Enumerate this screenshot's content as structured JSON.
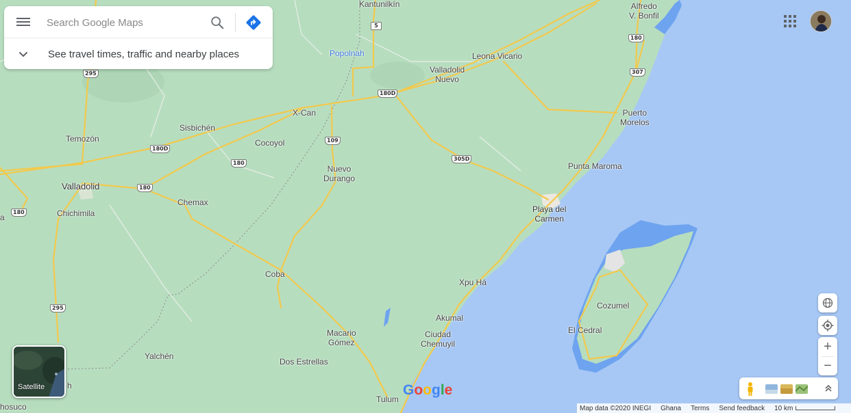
{
  "search": {
    "placeholder": "Search Google Maps",
    "travel_text": "See travel times, traffic and nearby places"
  },
  "map": {
    "places": [
      {
        "label": "Kantunilkín"
      },
      {
        "label": "Alfredo\nV. Bonfil"
      },
      {
        "label": "Popolnah",
        "style": "water"
      },
      {
        "label": "Leona Vicario"
      },
      {
        "label": "Valladolid\nNuevo"
      },
      {
        "label": "X-Can"
      },
      {
        "label": "Sisbichén"
      },
      {
        "label": "Temozón"
      },
      {
        "label": "Cocoyol"
      },
      {
        "label": "Nuevo\nDurango"
      },
      {
        "label": "Puerto\nMorelos"
      },
      {
        "label": "Valladolid"
      },
      {
        "label": "Chemax"
      },
      {
        "label": "Chichimila"
      },
      {
        "label": "Punta Maroma"
      },
      {
        "label": "Playa del\nCarmen"
      },
      {
        "label": "Coba"
      },
      {
        "label": "Xpu Há"
      },
      {
        "label": "Cozumel"
      },
      {
        "label": "El Cedral"
      },
      {
        "label": "Akumal"
      },
      {
        "label": "Ciudad\nChemuyil"
      },
      {
        "label": "Macario\nGómez"
      },
      {
        "label": "Yalchén"
      },
      {
        "label": "Dos Estrellas"
      },
      {
        "label": "Tulum"
      },
      {
        "label": "hosuco"
      },
      {
        "label": "a"
      },
      {
        "label": "h"
      }
    ],
    "shields": [
      {
        "label": "5"
      },
      {
        "label": "180"
      },
      {
        "label": "295"
      },
      {
        "label": "307"
      },
      {
        "label": "180D"
      },
      {
        "label": "180D"
      },
      {
        "label": "109"
      },
      {
        "label": "180"
      },
      {
        "label": "305D"
      },
      {
        "label": "180"
      },
      {
        "label": "180"
      },
      {
        "label": "295"
      }
    ]
  },
  "controls": {
    "satellite_label": "Satellite",
    "zoom_in": "+",
    "zoom_out": "−"
  },
  "footer": {
    "map_data": "Map data ©2020 INEGI",
    "region": "Ghana",
    "terms": "Terms",
    "feedback": "Send feedback",
    "scale": "10 km"
  },
  "logo": {
    "letters": [
      "G",
      "o",
      "o",
      "g",
      "l",
      "e"
    ]
  },
  "colors": {
    "land": "#b4dcbc",
    "water": "#a7c8f5",
    "lagoon": "#6ea3ef",
    "road": "#f5c85a",
    "accent": "#4285f4"
  }
}
